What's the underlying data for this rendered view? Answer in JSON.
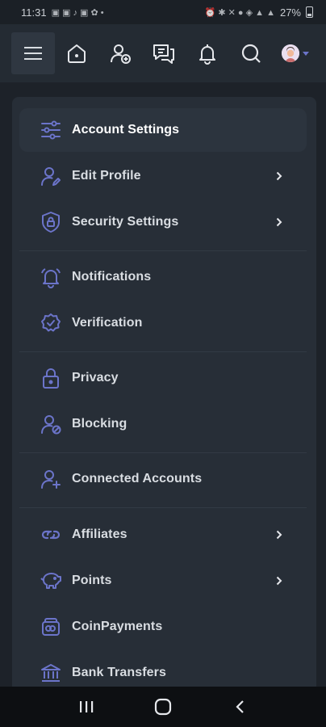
{
  "status_bar": {
    "time": "11:31",
    "battery": "27%"
  },
  "header": {
    "icons": [
      "menu-icon",
      "home-icon",
      "add-user-icon",
      "messages-icon",
      "bell-icon",
      "search-icon",
      "avatar"
    ]
  },
  "menu": {
    "items": [
      {
        "label": "Account Settings",
        "icon": "sliders-icon",
        "active": true,
        "chevron": false
      },
      {
        "label": "Edit Profile",
        "icon": "user-edit-icon",
        "active": false,
        "chevron": true
      },
      {
        "label": "Security Settings",
        "icon": "shield-lock-icon",
        "active": false,
        "chevron": true
      },
      {
        "label": "Notifications",
        "icon": "bell-icon",
        "active": false,
        "chevron": false
      },
      {
        "label": "Verification",
        "icon": "badge-check-icon",
        "active": false,
        "chevron": false
      },
      {
        "label": "Privacy",
        "icon": "lock-icon",
        "active": false,
        "chevron": false
      },
      {
        "label": "Blocking",
        "icon": "user-block-icon",
        "active": false,
        "chevron": false
      },
      {
        "label": "Connected Accounts",
        "icon": "user-plus-icon",
        "active": false,
        "chevron": false
      },
      {
        "label": "Affiliates",
        "icon": "link-icon",
        "active": false,
        "chevron": true
      },
      {
        "label": "Points",
        "icon": "piggy-bank-icon",
        "active": false,
        "chevron": true
      },
      {
        "label": "CoinPayments",
        "icon": "wallet-icon",
        "active": false,
        "chevron": false
      },
      {
        "label": "Bank Transfers",
        "icon": "bank-icon",
        "active": false,
        "chevron": false
      }
    ]
  },
  "colors": {
    "accent": "#6b74c9",
    "background": "#1d2229",
    "panel": "#272e37",
    "header": "#242b33"
  }
}
